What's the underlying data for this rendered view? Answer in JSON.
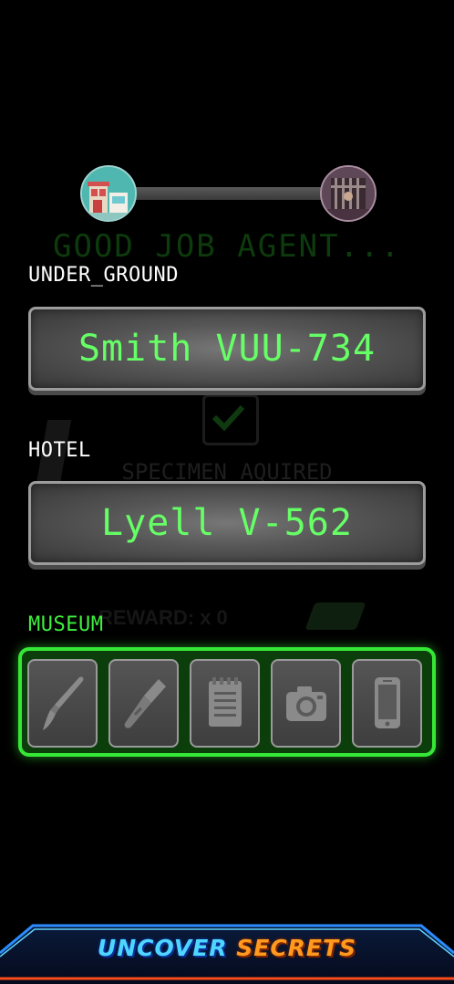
{
  "progress": {
    "fraction": 1.0,
    "start_icon": "shop-storefront-icon",
    "end_icon": "jail-cell-icon"
  },
  "background": {
    "heading": "GOOD JOB AGENT...",
    "status": "SPECIMEN AQUIRED",
    "reward_text": "REWARD: x 0"
  },
  "locations": [
    {
      "label": "UNDER_GROUND",
      "code": "Smith VUU-734"
    },
    {
      "label": "HOTEL",
      "code": "Lyell V-562"
    },
    {
      "label": "MUSEUM"
    }
  ],
  "tools": [
    {
      "name": "paintbrush-icon"
    },
    {
      "name": "scalpel-icon"
    },
    {
      "name": "notepad-icon"
    },
    {
      "name": "camera-icon"
    },
    {
      "name": "phone-icon"
    }
  ],
  "banner": {
    "word1": "UNCOVER",
    "word2": "SECRETS"
  },
  "colors": {
    "accent_green": "#3ef03e",
    "code_text": "#66ff66",
    "banner_blue": "#4fd6ff",
    "banner_orange": "#ff9a1e"
  }
}
